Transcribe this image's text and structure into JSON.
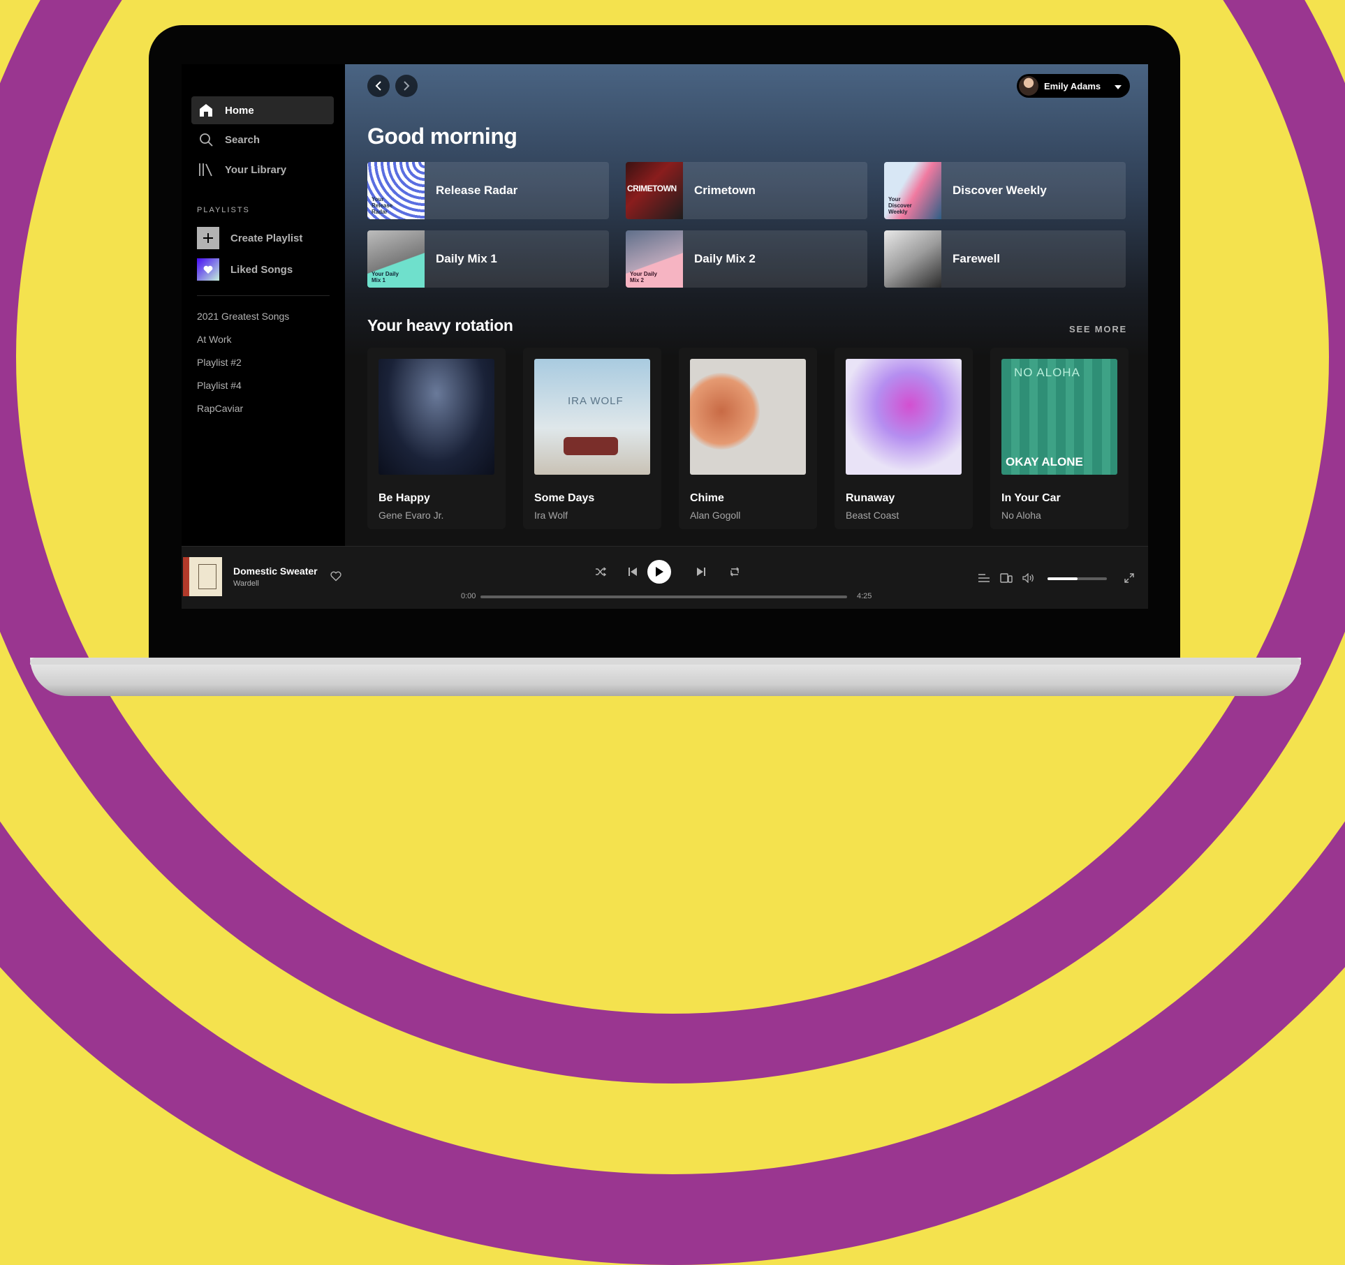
{
  "sidebar": {
    "nav": [
      {
        "label": "Home",
        "icon": "home-icon",
        "active": true
      },
      {
        "label": "Search",
        "icon": "search-icon"
      },
      {
        "label": "Your Library",
        "icon": "library-icon"
      }
    ],
    "section_label": "PLAYLISTS",
    "actions": [
      {
        "label": "Create Playlist",
        "icon": "plus-icon"
      },
      {
        "label": "Liked Songs",
        "icon": "heart-icon"
      }
    ],
    "playlists": [
      "2021 Greatest Songs",
      "At Work",
      "Playlist #2",
      "Playlist #4",
      "RapCaviar"
    ]
  },
  "header": {
    "user_name": "Emily Adams"
  },
  "main": {
    "greeting": "Good morning",
    "shortcuts": [
      {
        "name": "Release Radar",
        "art_text": "Your Release Radar"
      },
      {
        "name": "Crimetown",
        "art_text": "CRIMETOWN"
      },
      {
        "name": "Discover Weekly",
        "art_text": "Your Discover Weekly"
      },
      {
        "name": "Daily Mix 1",
        "art_text": "Your Daily Mix 1"
      },
      {
        "name": "Daily Mix 2",
        "art_text": "Your Daily Mix 2"
      },
      {
        "name": "Farewell",
        "art_text": ""
      }
    ],
    "heavy_rotation": {
      "title": "Your heavy rotation",
      "see_more": "SEE MORE",
      "cards": [
        {
          "title": "Be Happy",
          "artist": "Gene Evaro Jr."
        },
        {
          "title": "Some Days",
          "artist": "Ira Wolf",
          "art_text": "IRA WOLF"
        },
        {
          "title": "Chime",
          "artist": "Alan Gogoll"
        },
        {
          "title": "Runaway",
          "artist": "Beast Coast"
        },
        {
          "title": "In Your Car",
          "artist": "No Aloha",
          "art_text_top": "NO ALOHA",
          "art_text_bottom": "OKAY ALONE"
        }
      ]
    }
  },
  "player": {
    "track_title": "Domestic Sweater",
    "track_artist": "Wardell",
    "time_elapsed": "0:00",
    "time_total": "4:25",
    "progress_fraction": 0.0,
    "volume_fraction": 0.5
  },
  "colors": {
    "background_yellow": "#f4e24e",
    "background_purple": "#9a3690",
    "active_nav": "#282828",
    "main_gradient_top": "#4a6483",
    "card_bg": "#181818"
  }
}
